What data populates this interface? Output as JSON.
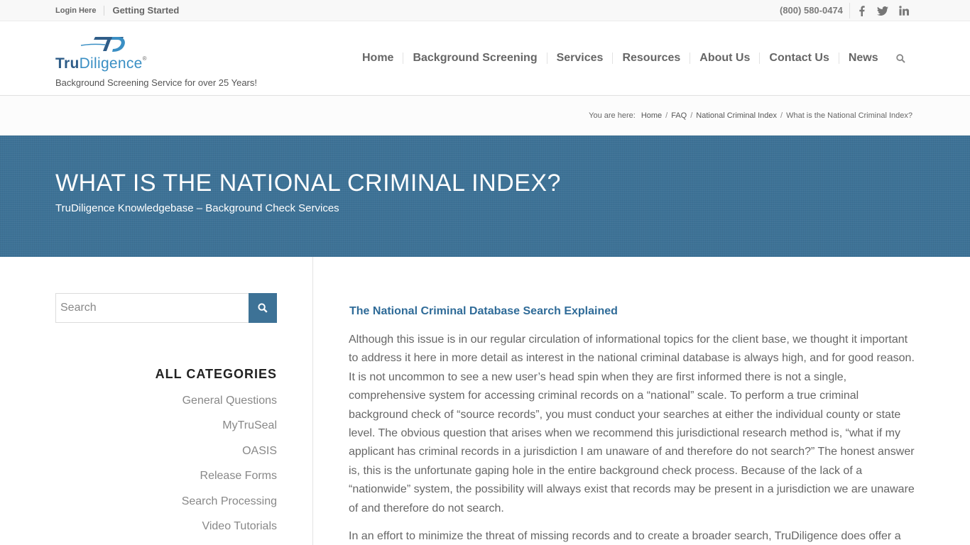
{
  "topbar": {
    "login_label": "Login Here",
    "getting_started_label": "Getting Started",
    "phone": "(800) 580-0474",
    "social": [
      {
        "icon": "facebook-icon",
        "label": "f"
      },
      {
        "icon": "twitter-icon",
        "label": "twitter"
      },
      {
        "icon": "linkedin-icon",
        "label": "in"
      }
    ]
  },
  "header": {
    "logo_tru": "Tru",
    "logo_diligence": "Diligence",
    "logo_mark": "®",
    "tagline": "Background Screening Service for over 25 Years!",
    "nav": [
      "Home",
      "Background Screening",
      "Services",
      "Resources",
      "About Us",
      "Contact Us",
      "News"
    ]
  },
  "breadcrumb": {
    "prefix": "You are here:",
    "items": [
      "Home",
      "FAQ",
      "National Criminal Index",
      "What is the National Criminal Index?"
    ]
  },
  "banner": {
    "title": "WHAT IS THE NATIONAL CRIMINAL INDEX?",
    "subtitle": "TruDiligence Knowledgebase – Background Check Services"
  },
  "sidebar": {
    "search_placeholder": "Search",
    "categories_title": "ALL CATEGORIES",
    "categories": [
      "General Questions",
      "MyTruSeal",
      "OASIS",
      "Release Forms",
      "Search Processing",
      "Video Tutorials"
    ]
  },
  "content": {
    "heading": "The National Criminal Database Search Explained",
    "paragraph1": "Although this issue is in our regular circulation of informational topics for the client base, we thought it important to address it here in more detail as interest in the national criminal database is always high, and for good reason.  It is not uncommon to see a new user’s head spin when they are first informed there is not a single, comprehensive system for accessing criminal records on a “national” scale. To perform a true criminal background check of “source records”, you must conduct your searches at either the individual county or state level.  The obvious question that arises when we recommend this jurisdictional research method is, “what if my applicant has criminal records in a jurisdiction I am unaware of and therefore do not search?”  The honest answer is, this is the unfortunate gaping hole in the entire background check process.  Because of the lack of a “nationwide” system, the possibility will always exist that records may be present in a jurisdiction we are unaware of and therefore do not search.",
    "paragraph2": "In an effort to minimize the threat of missing records and to create a broader search, TruDiligence does offer a"
  },
  "colors": {
    "banner": "#3d7296",
    "heading_blue": "#2f6b98",
    "logo_dark": "#2f5d88",
    "logo_light": "#3a8fc4"
  }
}
